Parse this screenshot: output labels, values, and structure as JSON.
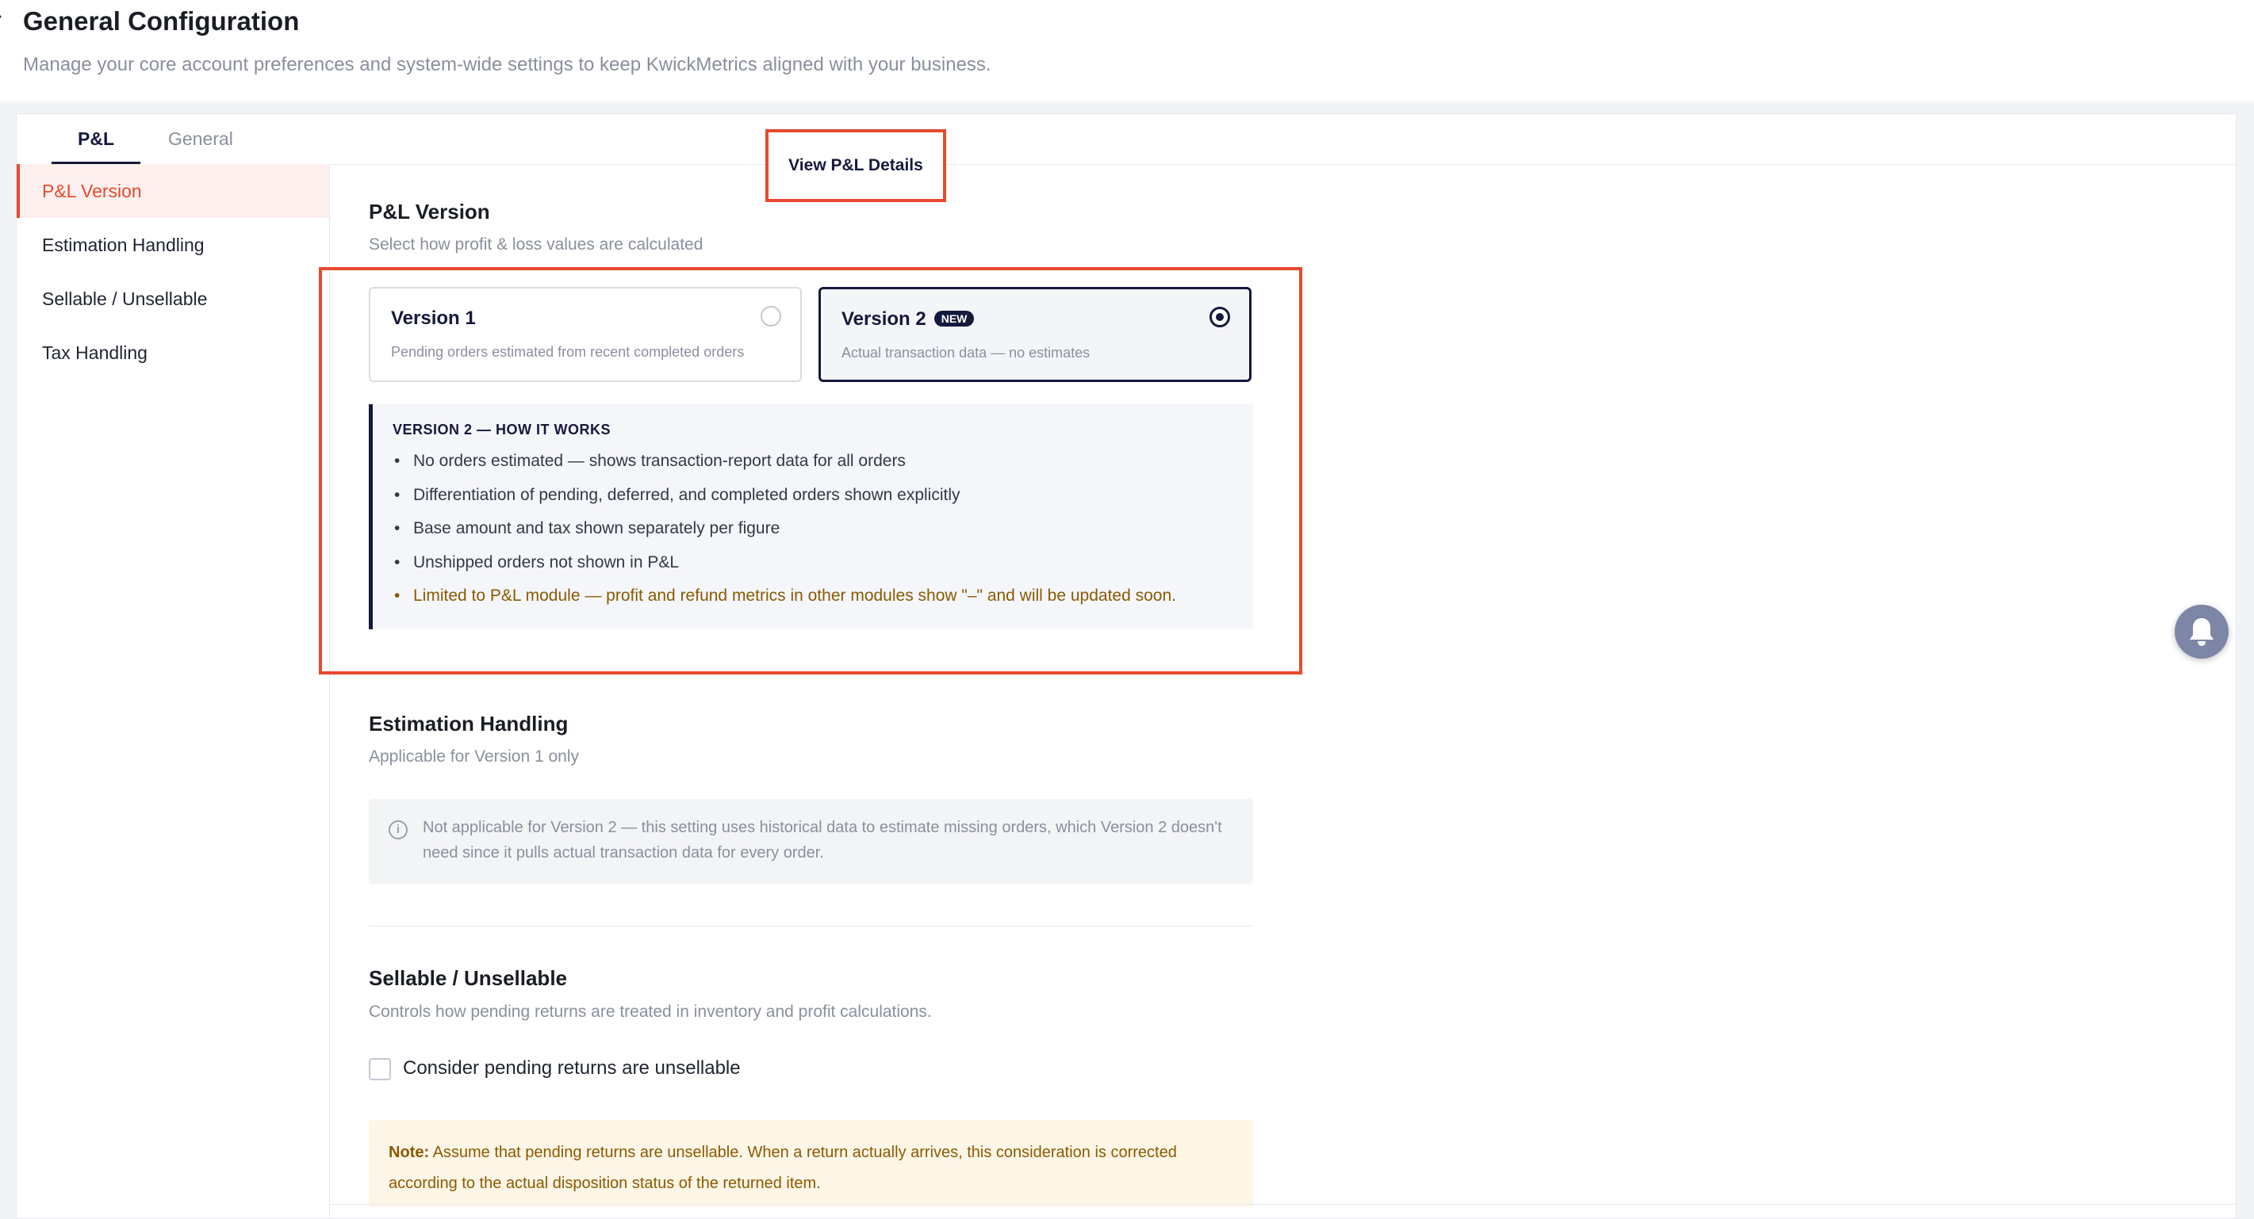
{
  "header": {
    "title": "General Configuration",
    "subtitle": "Manage your core account preferences and system-wide settings to keep KwickMetrics aligned with your business."
  },
  "tabs": {
    "pl": "P&L",
    "general": "General"
  },
  "sidebar": {
    "items": [
      {
        "label": "P&L Version",
        "active": true
      },
      {
        "label": "Estimation Handling",
        "active": false
      },
      {
        "label": "Sellable / Unsellable",
        "active": false
      },
      {
        "label": "Tax Handling",
        "active": false
      }
    ]
  },
  "pl_version": {
    "title": "P&L Version",
    "description": "Select how profit & loss values are calculated",
    "view_button": "View P&L Details",
    "version1": {
      "title": "Version 1",
      "description": "Pending orders estimated from recent completed orders",
      "selected": false
    },
    "version2": {
      "title": "Version 2",
      "badge": "NEW",
      "description": "Actual transaction data — no estimates",
      "selected": true
    },
    "how_it_works": {
      "title": "VERSION 2 — HOW IT WORKS",
      "items": [
        "No orders estimated — shows transaction-report data for all orders",
        "Differentiation of pending, deferred, and completed orders shown explicitly",
        "Base amount and tax shown separately per figure",
        "Unshipped orders not shown in P&L",
        "Limited to P&L module — profit and refund metrics in other modules show \"–\" and will be updated soon."
      ]
    }
  },
  "estimation": {
    "title": "Estimation Handling",
    "description": "Applicable for Version 1 only",
    "info_icon_glyph": "i",
    "info": "Not applicable for Version 2 — this setting uses historical data to estimate missing orders, which Version 2 doesn't need since it pulls actual transaction data for every order."
  },
  "sellable": {
    "title": "Sellable / Unsellable",
    "description": "Controls how pending returns are treated in inventory and profit calculations.",
    "checkbox_label": "Consider pending returns are unsellable",
    "checked": false,
    "note_label": "Note:",
    "note": " Assume that pending returns are unsellable. When a return actually arrives, this consideration is corrected according to the actual disposition status of the returned item."
  },
  "colors": {
    "accent": "#e64a2e",
    "navy": "#141a3c",
    "warning_text": "#8a5a00",
    "note_bg": "#fdf5e6"
  }
}
